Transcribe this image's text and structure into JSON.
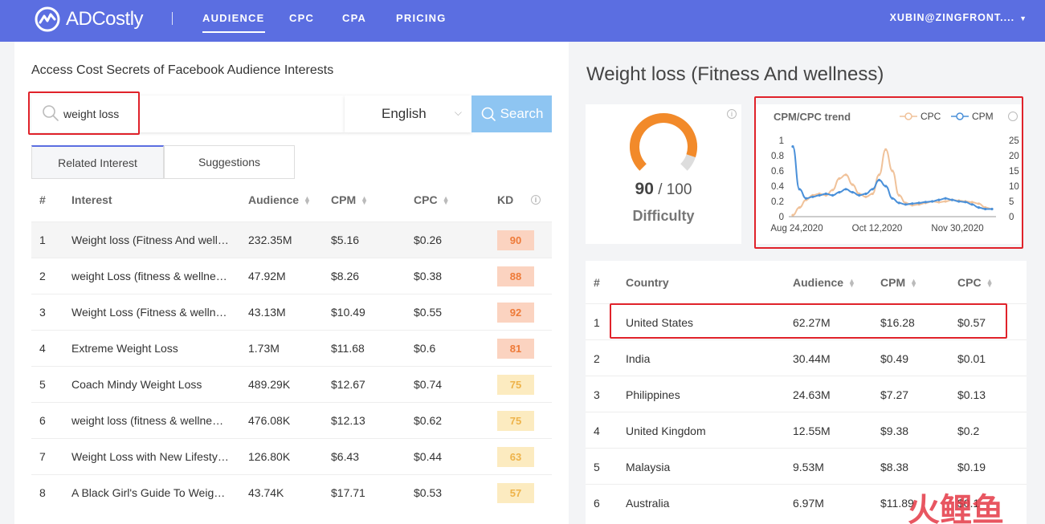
{
  "nav": {
    "logo": "ADCostly",
    "items": [
      "AUDIENCE",
      "CPC",
      "CPA",
      "PRICING"
    ],
    "user": "XUBIN@ZINGFRONT...."
  },
  "left": {
    "title": "Access Cost Secrets of Facebook Audience Interests",
    "search_value": "weight loss",
    "language": "English",
    "search_label": "Search",
    "tabs": [
      "Related Interest",
      "Suggestions"
    ],
    "columns": [
      "#",
      "Interest",
      "Audience",
      "CPM",
      "CPC",
      "KD"
    ],
    "rows": [
      {
        "n": "1",
        "interest": "Weight loss (Fitness And well…",
        "audience": "232.35M",
        "cpm": "$5.16",
        "cpc": "$0.26",
        "kd": "90"
      },
      {
        "n": "2",
        "interest": "weight Loss (fitness & wellne…",
        "audience": "47.92M",
        "cpm": "$8.26",
        "cpc": "$0.38",
        "kd": "88"
      },
      {
        "n": "3",
        "interest": "Weight Loss (Fitness & welln…",
        "audience": "43.13M",
        "cpm": "$10.49",
        "cpc": "$0.55",
        "kd": "92"
      },
      {
        "n": "4",
        "interest": "Extreme Weight Loss",
        "audience": "1.73M",
        "cpm": "$11.68",
        "cpc": "$0.6",
        "kd": "81"
      },
      {
        "n": "5",
        "interest": "Coach Mindy Weight Loss",
        "audience": "489.29K",
        "cpm": "$12.67",
        "cpc": "$0.74",
        "kd": "75"
      },
      {
        "n": "6",
        "interest": "weight loss (fitness & wellne…",
        "audience": "476.08K",
        "cpm": "$12.13",
        "cpc": "$0.62",
        "kd": "75"
      },
      {
        "n": "7",
        "interest": "Weight Loss with New Lifesty…",
        "audience": "126.80K",
        "cpm": "$6.43",
        "cpc": "$0.44",
        "kd": "63"
      },
      {
        "n": "8",
        "interest": "A Black Girl's Guide To Weig…",
        "audience": "43.74K",
        "cpm": "$17.71",
        "cpc": "$0.53",
        "kd": "57"
      }
    ]
  },
  "right": {
    "title": "Weight loss (Fitness And wellness)",
    "score": "90",
    "score_max": "/ 100",
    "difficulty_label": "Difficulty",
    "chart_title": "CPM/CPC trend",
    "columns": [
      "#",
      "Country",
      "Audience",
      "CPM",
      "CPC"
    ],
    "rows": [
      {
        "n": "1",
        "country": "United States",
        "audience": "62.27M",
        "cpm": "$16.28",
        "cpc": "$0.57"
      },
      {
        "n": "2",
        "country": "India",
        "audience": "30.44M",
        "cpm": "$0.49",
        "cpc": "$0.01"
      },
      {
        "n": "3",
        "country": "Philippines",
        "audience": "24.63M",
        "cpm": "$7.27",
        "cpc": "$0.13"
      },
      {
        "n": "4",
        "country": "United Kingdom",
        "audience": "12.55M",
        "cpm": "$9.38",
        "cpc": "$0.2"
      },
      {
        "n": "5",
        "country": "Malaysia",
        "audience": "9.53M",
        "cpm": "$8.38",
        "cpc": "$0.19"
      },
      {
        "n": "6",
        "country": "Australia",
        "audience": "6.97M",
        "cpm": "$11.89",
        "cpc": "$0.1"
      }
    ]
  },
  "chart_data": {
    "type": "line",
    "title": "CPM/CPC trend",
    "x_tick_labels": [
      "Aug 24,2020",
      "Oct 12,2020",
      "Nov 30,2020"
    ],
    "y_left_ticks": [
      "0",
      "0.2",
      "0.4",
      "0.6",
      "0.8",
      "1"
    ],
    "y_right_ticks": [
      "0",
      "5",
      "10",
      "15",
      "20",
      "25"
    ],
    "ylim_left": [
      0,
      1
    ],
    "ylim_right": [
      0,
      25
    ],
    "series": [
      {
        "name": "CPC",
        "axis": "left",
        "color": "#f0c29a",
        "values": [
          0.02,
          0.12,
          0.22,
          0.28,
          0.3,
          0.28,
          0.35,
          0.5,
          0.55,
          0.42,
          0.3,
          0.26,
          0.3,
          0.55,
          0.88,
          0.6,
          0.28,
          0.18,
          0.15,
          0.16,
          0.18,
          0.2,
          0.19,
          0.2,
          0.22,
          0.21,
          0.2,
          0.19,
          0.17,
          0.12,
          0.1
        ]
      },
      {
        "name": "CPM",
        "axis": "right",
        "color": "#4a90d9",
        "values": [
          23,
          9,
          6,
          6.5,
          7,
          7.5,
          7,
          8,
          9,
          8,
          7,
          7.5,
          9,
          12,
          10,
          6,
          4.5,
          4,
          4.3,
          4.5,
          4.8,
          5,
          5.5,
          6,
          5.5,
          5,
          4.8,
          4,
          3,
          2.5,
          2.5
        ]
      }
    ],
    "legend_position": "top-right"
  },
  "colors": {
    "nav": "#5b6ee1",
    "search_button": "#8ec5f2",
    "highlight_box": "#e0222a",
    "gauge": "#f28a2a",
    "kd_high_bg": "#fbd3c0",
    "kd_high_fg": "#ee7a38",
    "kd_mid_bg": "#fcebc0",
    "kd_mid_fg": "#eeb34a"
  }
}
